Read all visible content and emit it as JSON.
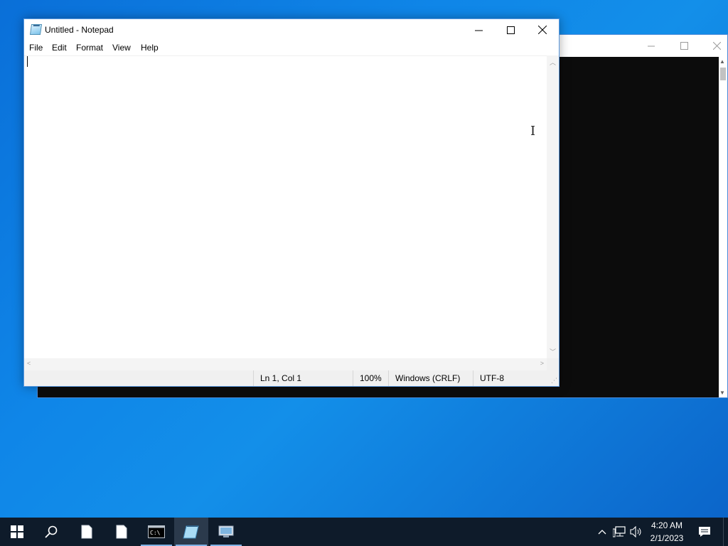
{
  "console": {
    "window_controls": {
      "minimize": "—",
      "maximize": "☐",
      "close": "✕"
    }
  },
  "notepad": {
    "title": "Untitled - Notepad",
    "window_controls": {
      "minimize": "—",
      "maximize": "☐",
      "close": "✕"
    },
    "menu": [
      "File",
      "Edit",
      "Format",
      "View",
      "Help"
    ],
    "content": "",
    "status": {
      "position": "Ln 1, Col 1",
      "zoom": "100%",
      "line_ending": "Windows (CRLF)",
      "encoding": "UTF-8"
    }
  },
  "taskbar": {
    "apps": [
      "start-icon",
      "search-icon",
      "file-icon",
      "file-icon",
      "cmd-icon",
      "notepad-icon",
      "network-app-icon"
    ],
    "clock": {
      "time": "4:20 AM",
      "date": "2/1/2023"
    },
    "tray_icons": [
      "chevron-up-icon",
      "network-icon",
      "volume-icon",
      "notification-icon"
    ]
  }
}
